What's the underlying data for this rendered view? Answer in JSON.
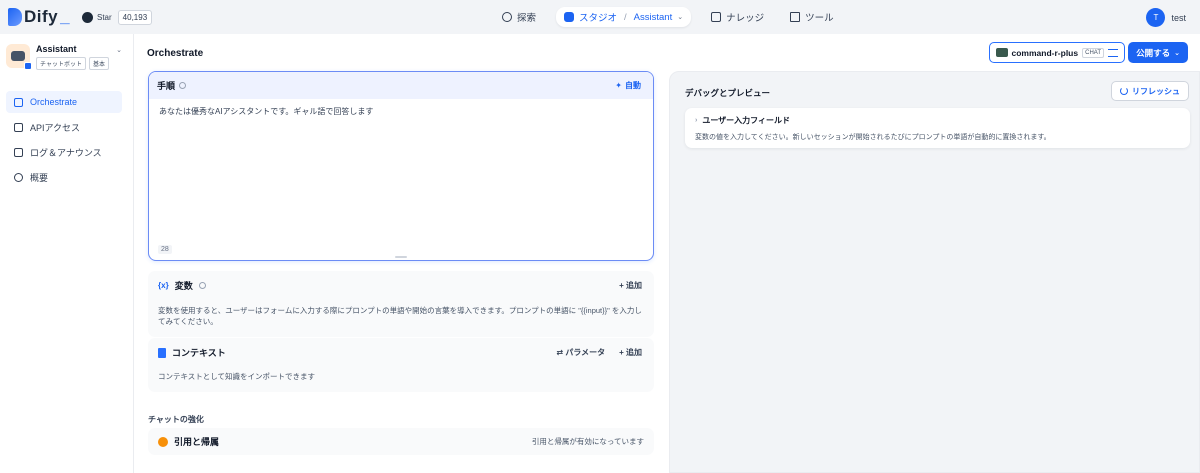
{
  "brand": {
    "name": "Dify",
    "accent": "#1c64f2"
  },
  "github": {
    "label": "Star",
    "count": "40,193"
  },
  "nav": {
    "explore": "探索",
    "studio": "スタジオ",
    "studio_app": "Assistant",
    "knowledge": "ナレッジ",
    "tools": "ツール"
  },
  "user": {
    "initial": "T",
    "name": "test"
  },
  "app": {
    "name": "Assistant",
    "tag_type": "チャットボット",
    "tag_mode": "基本"
  },
  "sidebar": {
    "items": [
      {
        "label": "Orchestrate",
        "icon": "layout-icon",
        "active": true
      },
      {
        "label": "APIアクセス",
        "icon": "terminal-icon",
        "active": false
      },
      {
        "label": "ログ＆アナウンス",
        "icon": "file-list-icon",
        "active": false
      },
      {
        "label": "概要",
        "icon": "dashboard-icon",
        "active": false
      }
    ]
  },
  "main": {
    "title": "Orchestrate",
    "model": {
      "name": "command-r-plus",
      "tag": "CHAT"
    },
    "publish_label": "公開する"
  },
  "prompt": {
    "title": "手順",
    "auto_label": "自動",
    "text": "あなたは優秀なAIアシスタントです。ギャル語で回答します",
    "char_count": "28"
  },
  "variables": {
    "title": "変数",
    "add_label": "追加",
    "description": "変数を使用すると、ユーザーはフォームに入力する際にプロンプトの単語や開始の言葉を導入できます。プロンプトの単語に \"{{input}}\" を入力してみてください。"
  },
  "context": {
    "title": "コンテキスト",
    "params_label": "パラメータ",
    "add_label": "追加",
    "description": "コンテキストとして知識をインポートできます"
  },
  "enhance": {
    "label": "チャットの強化",
    "citation_title": "引用と帰属",
    "citation_status": "引用と帰属が有効になっています"
  },
  "debug": {
    "title": "デバッグとプレビュー",
    "refresh_label": "リフレッシュ",
    "input_title": "ユーザー入力フィールド",
    "input_desc": "変数の値を入力してください。新しいセッションが開始されるたびにプロンプトの単語が自動的に置換されます。"
  }
}
